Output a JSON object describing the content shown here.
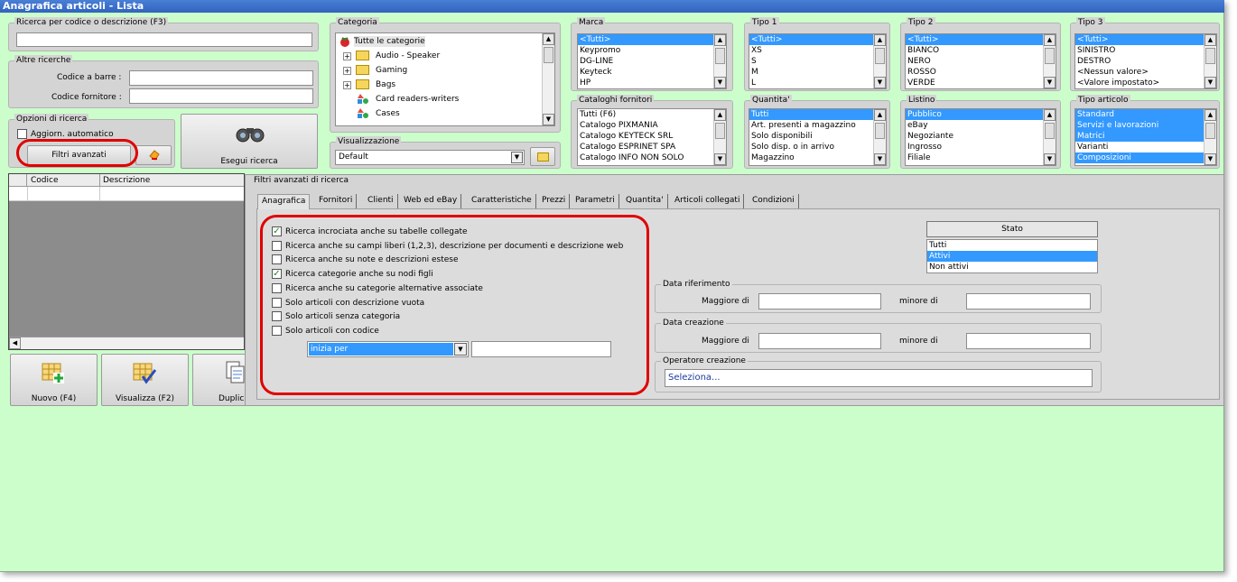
{
  "title": "Anagrafica articoli - Lista",
  "search": {
    "caption": "Ricerca per codice o descrizione (F3)",
    "value": ""
  },
  "other_search": {
    "caption": "Altre ricerche",
    "barcode_label": "Codice a barre :",
    "supplier_code_label": "Codice fornitore :"
  },
  "options": {
    "caption": "Opzioni di ricerca",
    "auto_update": "Aggiorn. automatico",
    "advanced_filters": "Filtri avanzati",
    "run_search": "Esegui ricerca"
  },
  "categoria": {
    "caption": "Categoria",
    "items": [
      "Tutte le categorie",
      "Audio - Speaker",
      "Gaming",
      "Bags",
      "Card readers-writers",
      "Cases"
    ]
  },
  "visualizzazione": {
    "caption": "Visualizzazione",
    "value": "Default"
  },
  "marca": {
    "caption": "Marca",
    "items": [
      "<Tutti>",
      "Keypromo",
      "DG-LINE",
      "Keyteck",
      "HP"
    ]
  },
  "tipo1": {
    "caption": "Tipo 1",
    "items": [
      "<Tutti>",
      "XS",
      "S",
      "M",
      "L"
    ]
  },
  "tipo2": {
    "caption": "Tipo 2",
    "items": [
      "<Tutti>",
      "BIANCO",
      "NERO",
      "ROSSO",
      "VERDE"
    ]
  },
  "tipo3": {
    "caption": "Tipo 3",
    "items": [
      "<Tutti>",
      "SINISTRO",
      "DESTRO",
      "<Nessun valore>",
      "<Valore impostato>"
    ]
  },
  "cataloghi": {
    "caption": "Cataloghi fornitori",
    "items": [
      "Tutti (F6)",
      "Catalogo PIXMANIA",
      "Catalogo KEYTECK SRL",
      "Catalogo ESPRINET SPA",
      "Catalogo INFO NON SOLO"
    ]
  },
  "quantita": {
    "caption": "Quantita'",
    "items": [
      "Tutti",
      "Art. presenti a magazzino",
      "Solo disponibili",
      "Solo disp. o in arrivo",
      "Magazzino"
    ]
  },
  "listino": {
    "caption": "Listino",
    "items": [
      "Pubblico",
      "eBay",
      "Negoziante",
      "Ingrosso",
      "Filiale"
    ]
  },
  "tipo_articolo": {
    "caption": "Tipo articolo",
    "items": [
      "Standard",
      "Servizi e lavorazioni",
      "Matrici",
      "Varianti",
      "Composizioni"
    ]
  },
  "grid": {
    "columns": [
      "Codice",
      "Descrizione"
    ]
  },
  "bottom_buttons": {
    "new": "Nuovo (F4)",
    "view": "Visualizza (F2)",
    "duplicate": "Duplic"
  },
  "advanced": {
    "caption": "Filtri avanzati di ricerca",
    "tabs": [
      "Anagrafica",
      "Fornitori",
      "Clienti",
      "Web ed eBay",
      "Caratteristiche",
      "Prezzi",
      "Parametri",
      "Quantita'",
      "Articoli collegati",
      "Condizioni"
    ],
    "checks": [
      {
        "label": "Ricerca incrociata anche su tabelle collegate",
        "checked": true
      },
      {
        "label": "Ricerca anche su campi liberi (1,2,3), descrizione per documenti e descrizione web",
        "checked": false
      },
      {
        "label": "Ricerca anche su note e descrizioni estese",
        "checked": false
      },
      {
        "label": "Ricerca categorie anche su nodi figli",
        "checked": true
      },
      {
        "label": "Ricerca anche su categorie alternative associate",
        "checked": false
      },
      {
        "label": "Solo articoli con descrizione vuota",
        "checked": false
      },
      {
        "label": "Solo articoli senza categoria",
        "checked": false
      },
      {
        "label": "Solo articoli con codice",
        "checked": false
      }
    ],
    "code_mode": "inizia per",
    "stato": {
      "header": "Stato",
      "items": [
        "Tutti",
        "Attivi",
        "Non attivi"
      ]
    },
    "data_riferimento": {
      "caption": "Data riferimento",
      "greater": "Maggiore di",
      "less": "minore di"
    },
    "data_creazione": {
      "caption": "Data creazione",
      "greater": "Maggiore di",
      "less": "minore di"
    },
    "operatore": {
      "caption": "Operatore creazione",
      "value": "Seleziona..."
    }
  },
  "colors": {
    "background": "#ccfecc",
    "selection": "#3399ff",
    "highlight_ring": "#e00000",
    "panel": "#d4d4d4"
  }
}
